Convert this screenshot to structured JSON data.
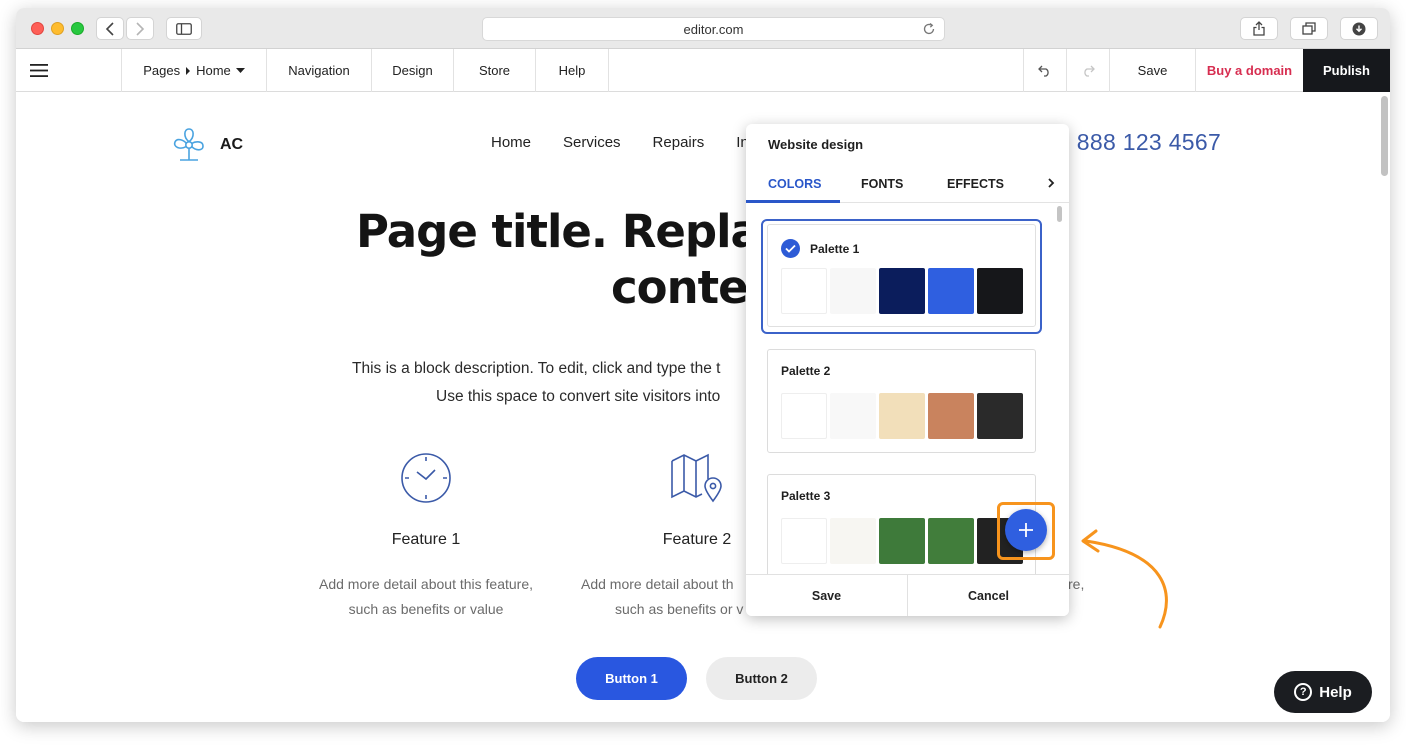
{
  "browser": {
    "url": "editor.com"
  },
  "toolbar": {
    "pages_label": "Pages",
    "current_page": "Home",
    "navigation": "Navigation",
    "design": "Design",
    "store": "Store",
    "help": "Help",
    "save": "Save",
    "buy_domain": "Buy a domain",
    "publish": "Publish"
  },
  "site": {
    "logo_text": "AC",
    "nav": [
      "Home",
      "Services",
      "Repairs",
      "In"
    ],
    "phone": "1 888 123 4567",
    "title_line1": "Page title. Replac",
    "title_line2": "conte",
    "desc_line1": "This is a block description. To edit, click and type the t",
    "desc_line2": "Use this space to convert site visitors into",
    "features": [
      {
        "title": "Feature 1",
        "desc1": "Add more detail about this feature,",
        "desc2": "such as benefits or value"
      },
      {
        "title": "Feature 2",
        "desc1": "Add more detail about th",
        "desc2": "such as benefits or v"
      }
    ],
    "feature3_desc_fragment": "re,",
    "button1": "Button 1",
    "button2": "Button 2",
    "help_button": "Help"
  },
  "design_panel": {
    "title": "Website design",
    "tabs": [
      "COLORS",
      "FONTS",
      "EFFECTS"
    ],
    "active_tab": "COLORS",
    "palettes": [
      {
        "name": "Palette 1",
        "selected": true,
        "colors": [
          "#ffffff",
          "#f7f7f7",
          "#0b1d5c",
          "#2f5fe0",
          "#16171a"
        ]
      },
      {
        "name": "Palette 2",
        "selected": false,
        "colors": [
          "#ffffff",
          "#f8f8f8",
          "#f2dfba",
          "#c9835e",
          "#2a2a2a"
        ]
      },
      {
        "name": "Palette 3",
        "selected": false,
        "colors": [
          "#ffffff",
          "#f7f6f2",
          "#3e7a3a",
          "#417d3b",
          "#222222"
        ]
      }
    ],
    "save": "Save",
    "cancel": "Cancel"
  },
  "accent_colors": {
    "brand_blue": "#2957e0",
    "highlight_orange": "#f7941d",
    "buy_domain_red": "#d72d50"
  }
}
